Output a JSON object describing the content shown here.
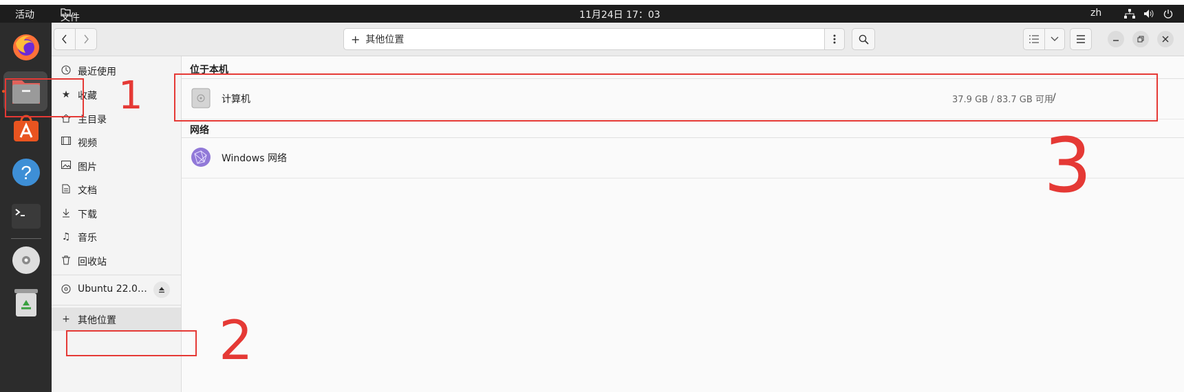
{
  "topbar": {
    "activities": "活动",
    "app_menu": "文件",
    "clock": "11月24日 17：03",
    "lang": "zh"
  },
  "dock": {
    "items": [
      "firefox-icon",
      "files-icon",
      "app-center-icon",
      "help-icon",
      "terminal-icon",
      "dvd-icon",
      "trash-icon"
    ]
  },
  "header": {
    "location": "其他位置"
  },
  "sidebar": {
    "items": [
      {
        "label": "最近使用",
        "icon": "clock-icon"
      },
      {
        "label": "收藏",
        "icon": "star-icon"
      },
      {
        "label": "主目录",
        "icon": "home-icon"
      },
      {
        "label": "视频",
        "icon": "video-icon"
      },
      {
        "label": "图片",
        "icon": "image-icon"
      },
      {
        "label": "文档",
        "icon": "document-icon"
      },
      {
        "label": "下载",
        "icon": "download-icon"
      },
      {
        "label": "音乐",
        "icon": "music-icon"
      },
      {
        "label": "回收站",
        "icon": "trash-icon"
      }
    ],
    "mount": "Ubuntu 22.0…",
    "other_locations": "其他位置"
  },
  "content": {
    "section_local": "位于本机",
    "computer": {
      "name": "计算机",
      "usage": "37.9 GB / 83.7 GB 可用",
      "path": "/"
    },
    "section_network": "网络",
    "network": {
      "name": "Windows 网络"
    }
  },
  "annotations": {
    "marker_1": "1",
    "marker_2": "2",
    "marker_3": "3"
  },
  "colors": {
    "annotation_red": "#e53935",
    "topbar": "#1d1d1d",
    "dock": "#2c2c2c",
    "selected": "#e3e3e3"
  }
}
